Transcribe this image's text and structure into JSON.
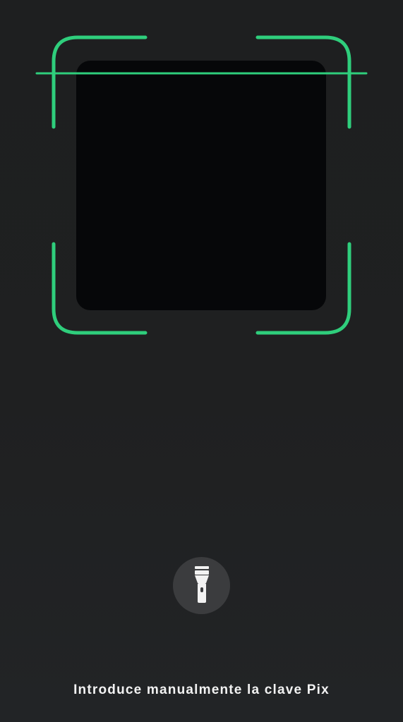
{
  "scanner": {
    "frame_color": "#2fce7c",
    "camera_area_color": "#060709"
  },
  "flashlight": {
    "icon": "flashlight-icon",
    "button_color": "#3b3c3e",
    "icon_color": "#f2f2f2"
  },
  "manual_entry": {
    "label": "Introduce manualmente la clave Pix"
  }
}
